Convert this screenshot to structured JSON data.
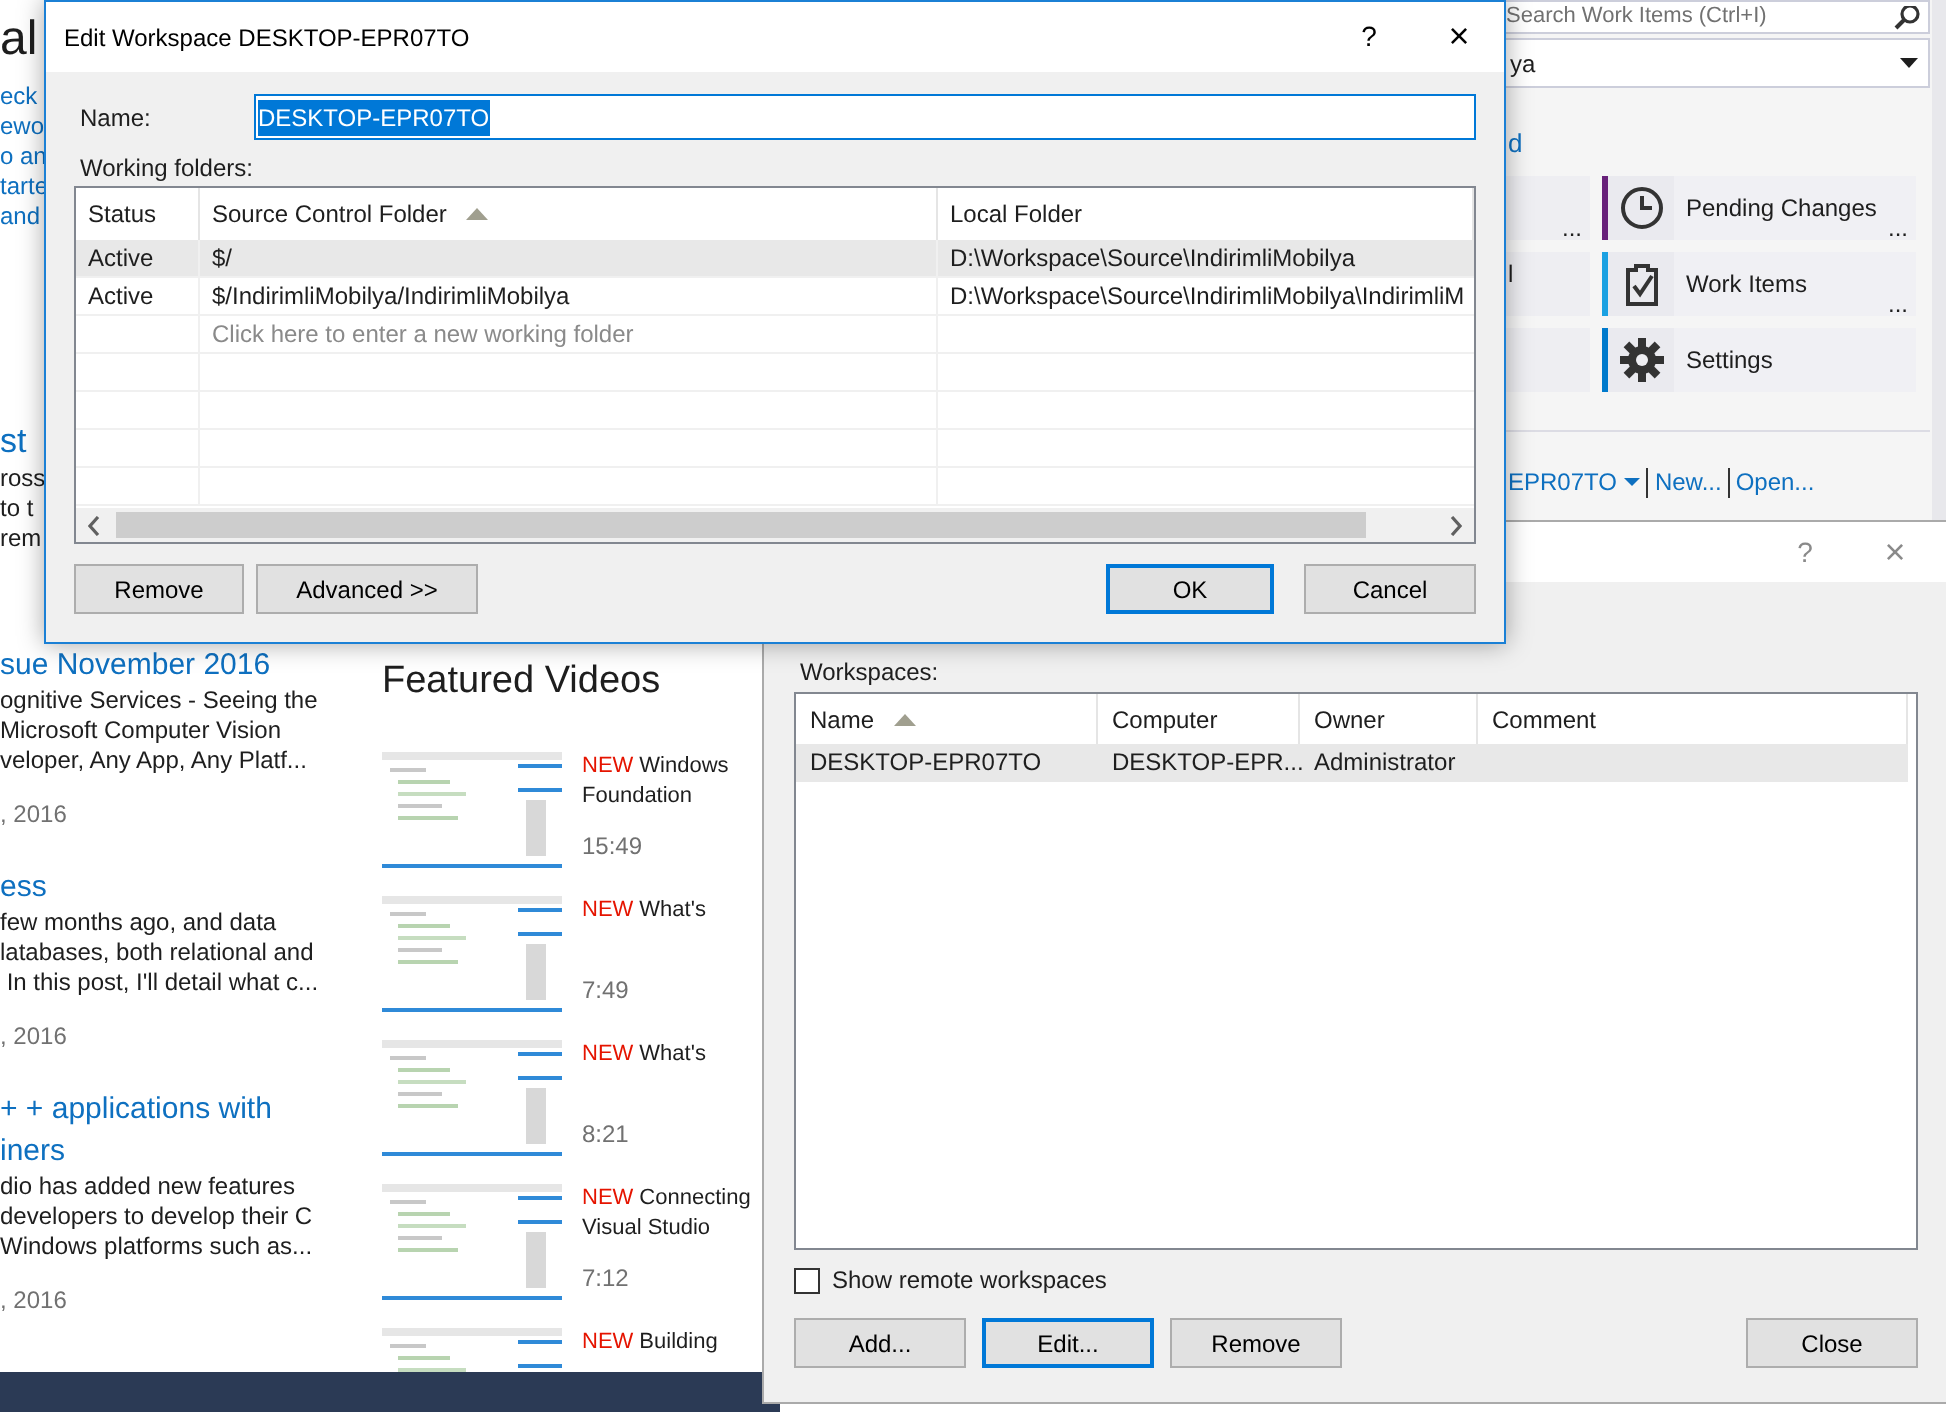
{
  "start_page": {
    "heading_fragment": "al",
    "intro_fragments": [
      "eck",
      "ewo",
      "o an",
      "tarte",
      "and"
    ],
    "article_fragment": {
      "title": "st",
      "lines": [
        "ross",
        "to t",
        "rem"
      ]
    },
    "news": [
      {
        "title_lines": [
          "sue November 2016"
        ],
        "summary_lines": [
          "ognitive Services - Seeing the",
          "Microsoft Computer Vision",
          "veloper, Any App, Any Platf..."
        ],
        "date": ", 2016"
      },
      {
        "title_lines": [
          "ess"
        ],
        "summary_lines": [
          "few months ago, and data",
          "latabases, both relational and",
          " In this post, I'll detail what c..."
        ],
        "date": ", 2016"
      },
      {
        "title_lines": [
          "+ + applications with",
          "iners"
        ],
        "summary_lines": [
          "dio has added new features",
          "developers to develop their C",
          "Windows platforms such as..."
        ],
        "date": ", 2016"
      }
    ],
    "featured_videos": {
      "title": "Featured Videos",
      "videos": [
        {
          "badge": "NEW",
          "title_lines": [
            "Windows",
            "Foundation"
          ],
          "duration": "15:49"
        },
        {
          "badge": "NEW",
          "title_lines": [
            "What's"
          ],
          "duration": "7:49"
        },
        {
          "badge": "NEW",
          "title_lines": [
            "What's"
          ],
          "duration": "8:21"
        },
        {
          "badge": "NEW",
          "title_lines": [
            "Connecting",
            "Visual Studio"
          ],
          "duration": "7:12"
        },
        {
          "badge": "NEW",
          "title_lines": [
            "Building"
          ]
        }
      ]
    }
  },
  "team_explorer": {
    "search": {
      "placeholder": "Search Work Items (Ctrl+I)"
    },
    "project_combo": {
      "value": "ya"
    },
    "link_fragment": "d",
    "left_tiles": [
      {
        "more": "..."
      },
      {
        "label": "l"
      }
    ],
    "tiles": [
      {
        "kind": "clock",
        "label": "Pending Changes",
        "color": "#68217a",
        "more": "..."
      },
      {
        "kind": "clipboard",
        "label": "Work Items",
        "color": "#1ba1e2",
        "more": "..."
      },
      {
        "kind": "gear",
        "label": "Settings",
        "color": "#007acc"
      }
    ],
    "workspace_links": [
      "EPR07TO",
      "New...",
      "Open..."
    ]
  },
  "edit_workspace_dialog": {
    "title": "Edit Workspace DESKTOP-EPR07TO",
    "help": "?",
    "close": "×",
    "name_label": "Name:",
    "name_field": {
      "value": "DESKTOP-EPR07TO",
      "text_selected": true
    },
    "folders_label": "Working folders:",
    "columns": [
      {
        "label": "Status",
        "sorted": false
      },
      {
        "label": "Source Control Folder",
        "sorted": true
      },
      {
        "label": "Local Folder",
        "sorted": false
      }
    ],
    "rows": [
      {
        "status": "Active",
        "source": "$/",
        "local": "D:\\Workspace\\Source\\IndirimliMobilya",
        "selected": true
      },
      {
        "status": "Active",
        "source": "$/IndirimliMobilya/IndirimliMobilya",
        "local": "D:\\Workspace\\Source\\IndirimliMobilya\\IndirimliM",
        "selected": false
      }
    ],
    "new_row_placeholder": "Click here to enter a new working folder",
    "buttons": [
      {
        "label": "Remove",
        "default": false
      },
      {
        "label": "Advanced >>",
        "default": false
      },
      {
        "label": "OK",
        "default": true
      },
      {
        "label": "Cancel",
        "default": false
      }
    ]
  },
  "manage_workspaces_dialog": {
    "help": "?",
    "close": "×",
    "workspaces_label": "Workspaces:",
    "columns": [
      {
        "label": "Name",
        "sorted": true
      },
      {
        "label": "Computer",
        "sorted": false
      },
      {
        "label": "Owner",
        "sorted": false
      },
      {
        "label": "Comment",
        "sorted": false
      }
    ],
    "rows": [
      {
        "cells": [
          "DESKTOP-EPR07TO",
          "DESKTOP-EPR...",
          "Administrator",
          ""
        ],
        "selected": true
      }
    ],
    "show_remote": {
      "label": "Show remote workspaces",
      "checked": false
    },
    "buttons": [
      {
        "label": "Add...",
        "default": false
      },
      {
        "label": "Edit...",
        "default": true
      },
      {
        "label": "Remove",
        "default": false
      },
      {
        "label": "Close",
        "default": false
      }
    ]
  }
}
